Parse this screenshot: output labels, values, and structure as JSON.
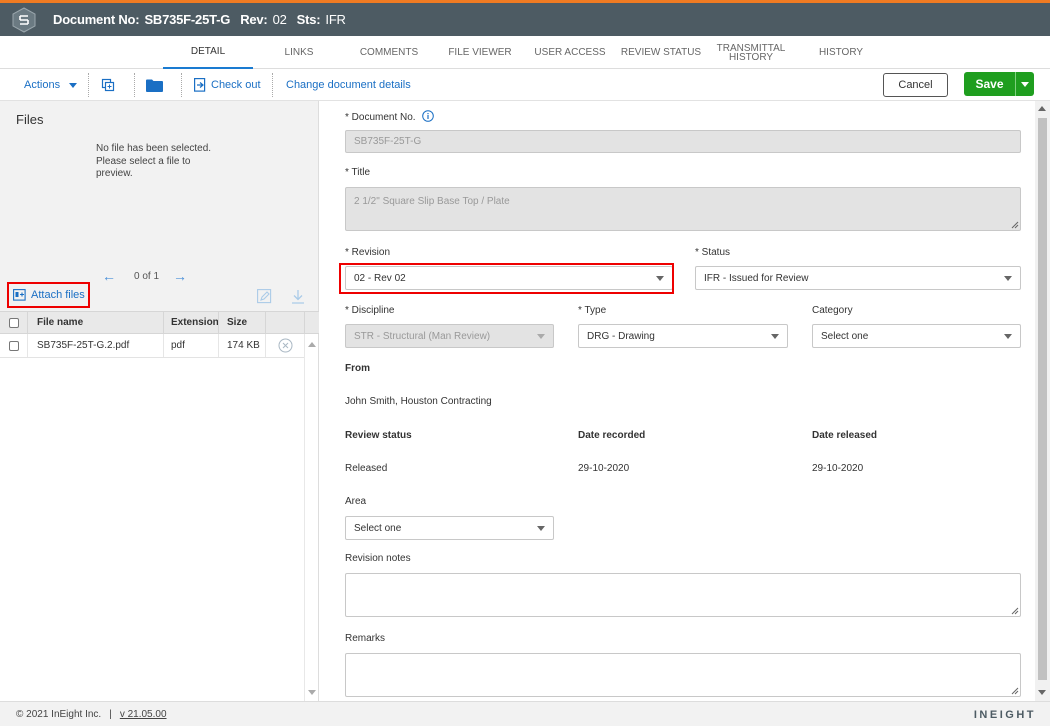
{
  "header": {
    "doc_label": "Document No:",
    "doc_value": "SB735F-25T-G",
    "rev_label": "Rev:",
    "rev_value": "02",
    "sts_label": "Sts:",
    "sts_value": "IFR"
  },
  "tabs": [
    {
      "label": "DETAIL"
    },
    {
      "label": "LINKS"
    },
    {
      "label": "COMMENTS"
    },
    {
      "label": "FILE VIEWER"
    },
    {
      "label": "USER ACCESS"
    },
    {
      "label": "REVIEW STATUS"
    },
    {
      "label": "TRANSMITTAL HISTORY"
    },
    {
      "label": "HISTORY"
    }
  ],
  "toolbar": {
    "actions_label": "Actions",
    "checkout_label": "Check out",
    "change_details_label": "Change document details",
    "cancel_label": "Cancel",
    "save_label": "Save"
  },
  "files": {
    "title": "Files",
    "empty_message": "No file has been selected. Please select a file to preview.",
    "pager": "0 of 1",
    "attach_label": "Attach files",
    "columns": {
      "name": "File name",
      "extension": "Extension",
      "size": "Size"
    },
    "rows": [
      {
        "name": "SB735F-25T-G.2.pdf",
        "extension": "pdf",
        "size": "174 KB"
      }
    ]
  },
  "form": {
    "doc_no_label": "* Document No.",
    "doc_no_value": "SB735F-25T-G",
    "title_label": "* Title",
    "title_value": "2 1/2\" Square Slip Base Top / Plate",
    "revision_label": "* Revision",
    "revision_value": "02 - Rev 02",
    "status_label": "* Status",
    "status_value": "IFR - Issued for Review",
    "discipline_label": "* Discipline",
    "discipline_value": "STR - Structural (Man Review)",
    "type_label": "* Type",
    "type_value": "DRG - Drawing",
    "category_label": "Category",
    "category_value": "Select one",
    "from_label": "From",
    "from_value": "John Smith, Houston Contracting",
    "review_status_label": "Review status",
    "review_status_value": "Released",
    "date_recorded_label": "Date recorded",
    "date_recorded_value": "29-10-2020",
    "date_released_label": "Date released",
    "date_released_value": "29-10-2020",
    "area_label": "Area",
    "area_value": "Select one",
    "revision_notes_label": "Revision notes",
    "remarks_label": "Remarks"
  },
  "footer": {
    "copyright": "© 2021 InEight Inc.",
    "separator": "|",
    "version": "v 21.05.00",
    "brand": "INEIGHT"
  },
  "colors": {
    "accent": "#1a6fc4",
    "header_bg": "#4d5b63",
    "header_top_border": "#f07b22",
    "save_green": "#1f9e1f",
    "highlight_red": "#e00000"
  }
}
